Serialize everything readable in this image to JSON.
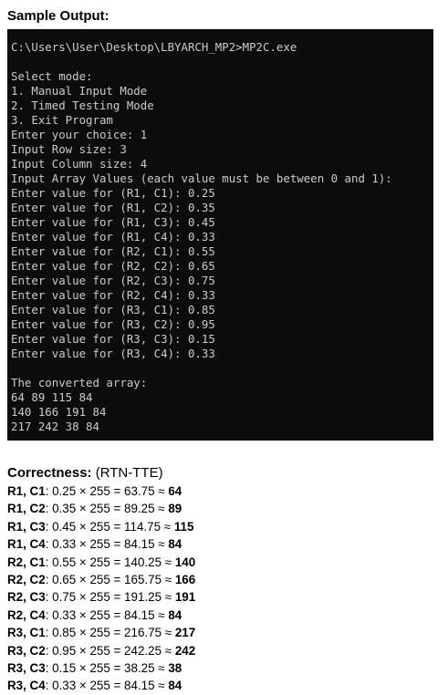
{
  "heading": "Sample Output:",
  "console": {
    "lines": [
      "C:\\Users\\User\\Desktop\\LBYARCH_MP2>MP2C.exe",
      "",
      "Select mode:",
      "1. Manual Input Mode",
      "2. Timed Testing Mode",
      "3. Exit Program",
      "Enter your choice: 1",
      "Input Row size: 3",
      "Input Column size: 4",
      "Input Array Values (each value must be between 0 and 1):",
      "Enter value for (R1, C1): 0.25",
      "Enter value for (R1, C2): 0.35",
      "Enter value for (R1, C3): 0.45",
      "Enter value for (R1, C4): 0.33",
      "Enter value for (R2, C1): 0.55",
      "Enter value for (R2, C2): 0.65",
      "Enter value for (R2, C3): 0.75",
      "Enter value for (R2, C4): 0.33",
      "Enter value for (R3, C1): 0.85",
      "Enter value for (R3, C2): 0.95",
      "Enter value for (R3, C3): 0.15",
      "Enter value for (R3, C4): 0.33",
      "",
      "The converted array:",
      "64 89 115 84",
      "140 166 191 84",
      "217 242 38 84"
    ]
  },
  "correctness": {
    "title": "Correctness:",
    "subtitle": " (RTN-TTE)",
    "rows": [
      {
        "cell": "R1, C1",
        "formula": ": 0.25 × 255 = 63.75 ≈ ",
        "result": "64"
      },
      {
        "cell": "R1, C2",
        "formula": ": 0.35 × 255 = 89.25 ≈ ",
        "result": "89"
      },
      {
        "cell": "R1, C3",
        "formula": ": 0.45 × 255 = 114.75 ≈ ",
        "result": "115"
      },
      {
        "cell": "R1, C4",
        "formula": ": 0.33 × 255 = 84.15 ≈ ",
        "result": "84"
      },
      {
        "cell": "R2, C1",
        "formula": ": 0.55 × 255 = 140.25 ≈ ",
        "result": "140"
      },
      {
        "cell": "R2, C2",
        "formula": ": 0.65 × 255 = 165.75 ≈ ",
        "result": "166"
      },
      {
        "cell": "R2, C3",
        "formula": ": 0.75 × 255 = 191.25 ≈ ",
        "result": "191"
      },
      {
        "cell": "R2, C4",
        "formula": ": 0.33 × 255 = 84.15 ≈ ",
        "result": "84"
      },
      {
        "cell": "R3, C1",
        "formula": ": 0.85 × 255 = 216.75 ≈ ",
        "result": "217"
      },
      {
        "cell": "R3, C2",
        "formula": ": 0.95 × 255 = 242.25 ≈ ",
        "result": "242"
      },
      {
        "cell": "R3, C3",
        "formula": ": 0.15 × 255 = 38.25 ≈ ",
        "result": "38"
      },
      {
        "cell": "R3, C4",
        "formula": ": 0.33 × 255 = 84.15 ≈ ",
        "result": "84"
      }
    ]
  },
  "colors": {
    "console_background": "#0c0c0c",
    "console_text": "#cccccc",
    "page_background": "#ffffff",
    "text": "#000000"
  }
}
